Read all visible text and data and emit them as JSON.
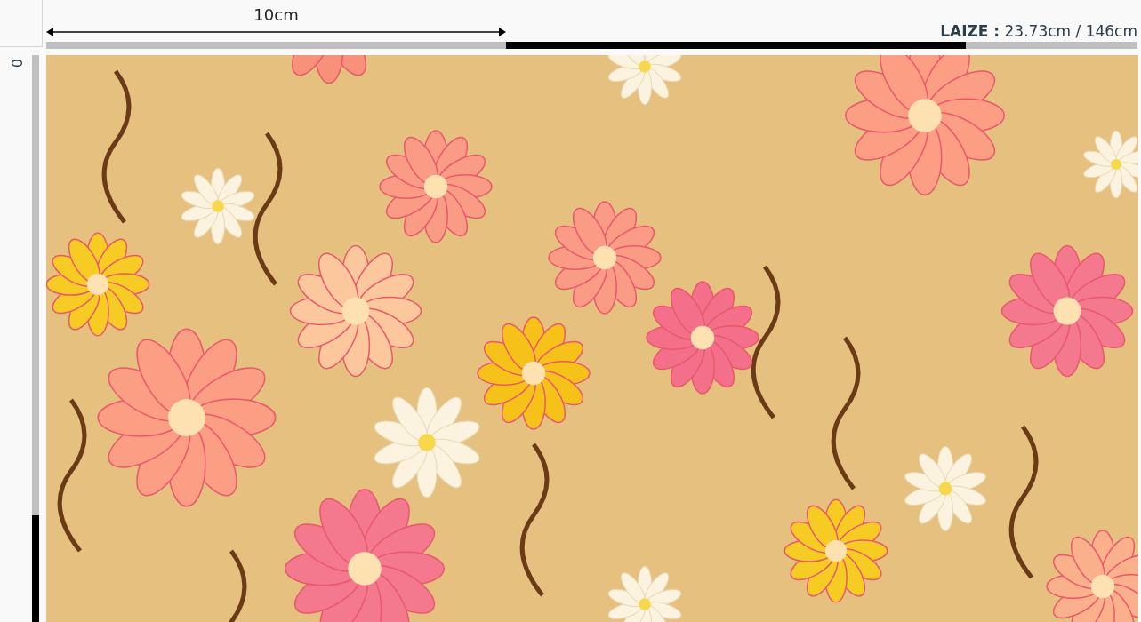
{
  "top_ruler": {
    "span_label": "10cm",
    "width_label": "**LAIZE :** 23.73cm / 146cm"
  },
  "side_ruler": {
    "label": "0"
  }
}
